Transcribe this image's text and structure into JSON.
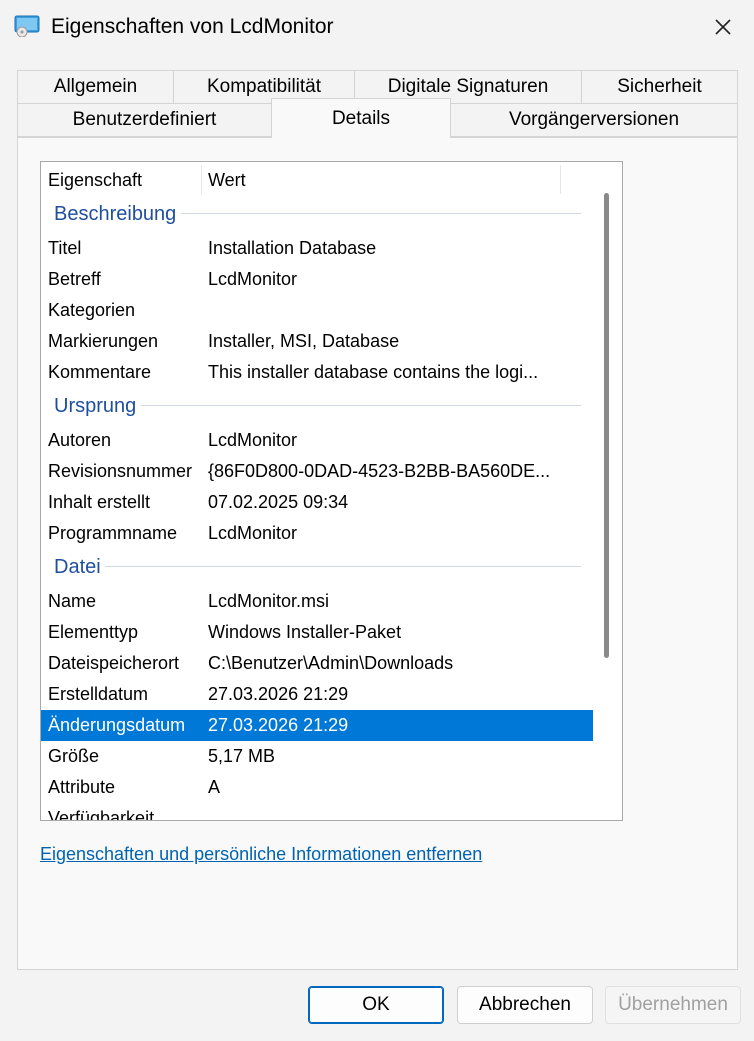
{
  "window": {
    "title": "Eigenschaften von LcdMonitor",
    "icon": "msi-package-icon"
  },
  "tabs": {
    "row1": [
      "Allgemein",
      "Kompatibilität",
      "Digitale Signaturen",
      "Sicherheit"
    ],
    "row2": [
      "Benutzerdefiniert",
      "Details",
      "Vorgängerversionen"
    ],
    "active": "Details"
  },
  "list": {
    "header": {
      "property": "Eigenschaft",
      "value": "Wert"
    },
    "groups": [
      {
        "label": "Beschreibung",
        "rows": [
          {
            "k": "Titel",
            "v": "Installation Database"
          },
          {
            "k": "Betreff",
            "v": "LcdMonitor"
          },
          {
            "k": "Kategorien",
            "v": ""
          },
          {
            "k": "Markierungen",
            "v": "Installer, MSI, Database"
          },
          {
            "k": "Kommentare",
            "v": "This installer database contains the logi..."
          }
        ]
      },
      {
        "label": "Ursprung",
        "rows": [
          {
            "k": "Autoren",
            "v": "LcdMonitor"
          },
          {
            "k": "Revisionsnummer",
            "v": "{86F0D800-0DAD-4523-B2BB-BA560DE..."
          },
          {
            "k": "Inhalt erstellt",
            "v": "07.02.2025 09:34"
          },
          {
            "k": "Programmname",
            "v": "LcdMonitor"
          }
        ]
      },
      {
        "label": "Datei",
        "rows": [
          {
            "k": "Name",
            "v": "LcdMonitor.msi"
          },
          {
            "k": "Elementtyp",
            "v": "Windows Installer-Paket"
          },
          {
            "k": "Dateispeicherort",
            "v": "C:\\Benutzer\\Admin\\Downloads"
          },
          {
            "k": "Erstelldatum",
            "v": "27.03.2026 21:29"
          },
          {
            "k": "Änderungsdatum",
            "v": "27.03.2026 21:29",
            "selected": true
          },
          {
            "k": "Größe",
            "v": "5,17 MB"
          },
          {
            "k": "Attribute",
            "v": "A"
          },
          {
            "k": "Verfügbarkeit",
            "v": ""
          }
        ]
      }
    ]
  },
  "link": {
    "remove_info": "Eigenschaften und persönliche Informationen entfernen"
  },
  "buttons": {
    "ok": "OK",
    "cancel": "Abbrechen",
    "apply": "Übernehmen"
  }
}
